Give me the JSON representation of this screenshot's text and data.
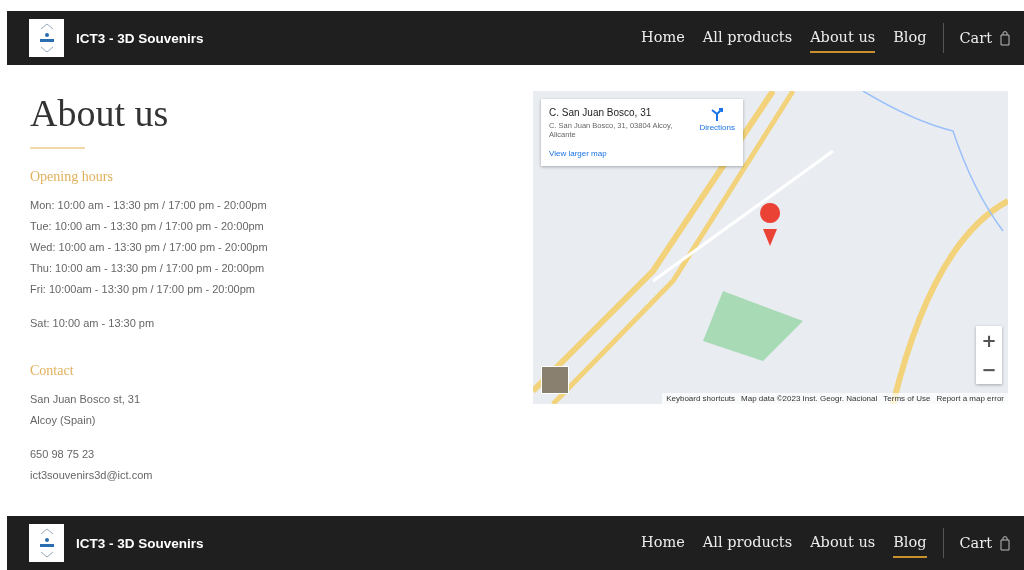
{
  "header": {
    "brand": "ICT3 - 3D Souvenirs",
    "nav": [
      {
        "label": "Home",
        "selected": false
      },
      {
        "label": "All products",
        "selected": false
      },
      {
        "label": "About us",
        "selected": true
      },
      {
        "label": "Blog",
        "selected": false
      }
    ],
    "cart": "Cart"
  },
  "title": "About us",
  "sections": [
    {
      "heading": "Opening hours",
      "groups": [
        [
          "Mon: 10:00 am - 13:30 pm / 17:00 pm - 20:00pm",
          "Tue: 10:00 am - 13:30 pm / 17:00 pm - 20:00pm",
          "Wed: 10:00 am - 13:30 pm / 17:00 pm - 20:00pm",
          "Thu: 10:00 am - 13:30 pm / 17:00 pm - 20:00pm",
          "Fri: 10:00am - 13:30 pm / 17:00 pm - 20:00pm"
        ],
        [
          "Sat: 10:00 am - 13:30 pm"
        ]
      ]
    },
    {
      "heading": "Contact",
      "groups": [
        [
          "San Juan Bosco st, 31",
          "Alcoy (Spain)"
        ],
        [
          "650 98 75 23",
          "ict3souvenirs3d@ict.com"
        ]
      ]
    }
  ],
  "map": {
    "place": "C. San Juan Bosco, 31",
    "address": "C. San Juan Bosco, 31, 03804 Alcoy, Alicante",
    "directions": "Directions",
    "larger_map": "View larger map",
    "zoom_in": "+",
    "zoom_out": "−",
    "footer": [
      "Keyboard shortcuts",
      "Map data ©2023 Inst. Geogr. Nacional",
      "Terms of Use",
      "Report a map error"
    ]
  },
  "footer": {
    "brand": "ICT3 - 3D Souvenirs",
    "nav": [
      {
        "label": "Home",
        "selected": false
      },
      {
        "label": "All products",
        "selected": false
      },
      {
        "label": "About us",
        "selected": false
      },
      {
        "label": "Blog",
        "selected": true
      }
    ],
    "cart": "Cart"
  }
}
